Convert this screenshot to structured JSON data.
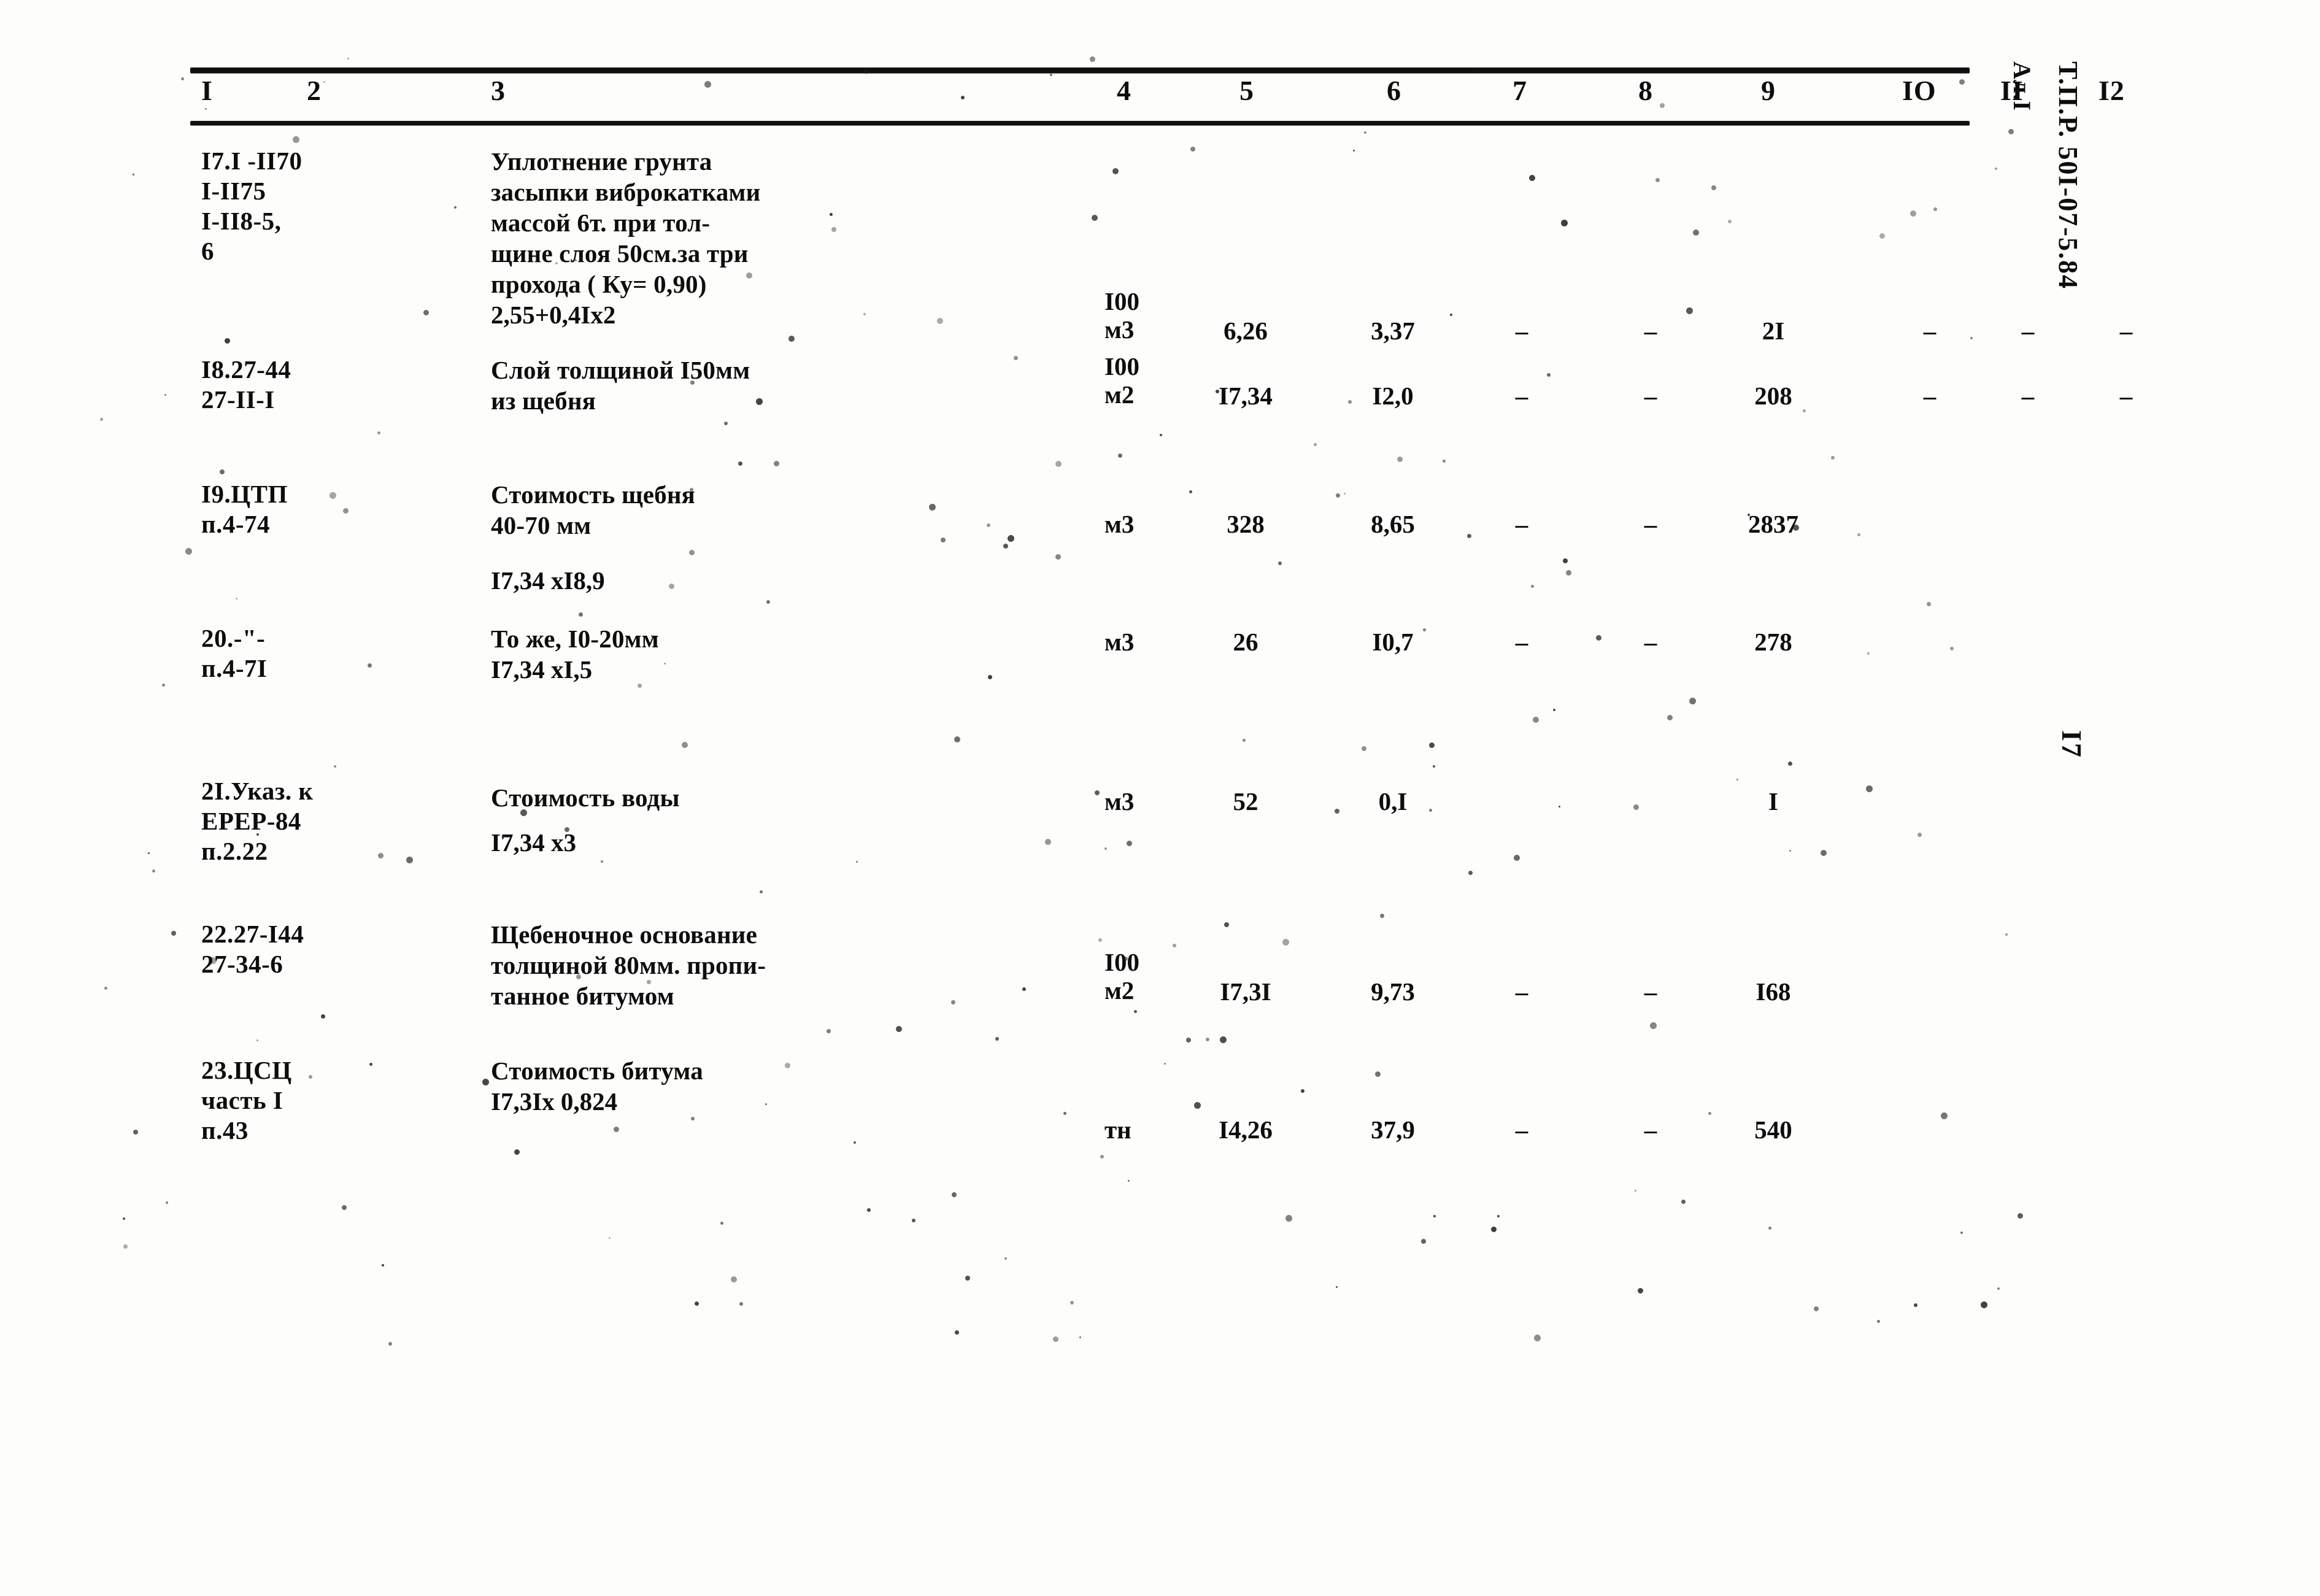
{
  "document": {
    "side_title": "Т.П.Р. 50I-07-5.84",
    "side_sub": "Ал.I",
    "page_number": "I7"
  },
  "table": {
    "column_headers": [
      "I",
      "2",
      "3",
      "4",
      "5",
      "6",
      "7",
      "8",
      "9",
      "IO",
      "II",
      "I2"
    ],
    "rows": [
      {
        "code": "I7.I -II70\nI-II75\nI-II8-5,\n6",
        "description": "Уплотнение грунта\nзасыпки виброкатками\nмассой 6т. при тол-\nщине слоя 50см.за три\nпрохода ( Ку= 0,90)",
        "calc": "2,55+0,4Ix2",
        "unit": "I00\nм3",
        "c5": "6,26",
        "c6": "3,37",
        "c7": "–",
        "c8": "–",
        "c9": "2I",
        "c10": "–",
        "c11": "–",
        "c12": "–"
      },
      {
        "code": "I8.27-44\n27-II-I",
        "description": "Слой толщиной   I50мм\nиз щебня",
        "calc": "",
        "unit": "I00\nм2",
        "c5": "I7,34",
        "c6": "I2,0",
        "c7": "–",
        "c8": "–",
        "c9": "208",
        "c10": "–",
        "c11": "–",
        "c12": "–"
      },
      {
        "code": "I9.ЦТП\nп.4-74",
        "description": "Стоимость щебня\n40-70 мм",
        "calc": "I7,34 xI8,9",
        "unit": "м3",
        "c5": "328",
        "c6": "8,65",
        "c7": "–",
        "c8": "–",
        "c9": "2837",
        "c10": "",
        "c11": "",
        "c12": ""
      },
      {
        "code": "20.-\"-\nп.4-7I",
        "description": "То же, I0-20мм",
        "calc": "I7,34 xI,5",
        "unit": "м3",
        "c5": "26",
        "c6": "I0,7",
        "c7": "–",
        "c8": "–",
        "c9": "278",
        "c10": "",
        "c11": "",
        "c12": ""
      },
      {
        "code": "2I.Указ. к\nЕРЕР-84\nп.2.22",
        "description": "Стоимость воды",
        "calc": "I7,34 х3",
        "unit": "м3",
        "c5": "52",
        "c6": "0,I",
        "c7": "",
        "c8": "",
        "c9": "I",
        "c10": "",
        "c11": "",
        "c12": ""
      },
      {
        "code": "22.27-I44\n27-34-6",
        "description": "Щебеночное основание\nтолщиной 80мм. пропи-\nтанное битумом",
        "calc": "",
        "unit": "I00\nм2",
        "c5": "I7,3I",
        "c6": "9,73",
        "c7": "–",
        "c8": "–",
        "c9": "I68",
        "c10": "",
        "c11": "",
        "c12": ""
      },
      {
        "code": "23.ЦСЦ\nчасть I\nп.43",
        "description": "Стоимость битума",
        "calc": "I7,3Iх 0,824",
        "unit": "тн",
        "c5": "I4,26",
        "c6": "37,9",
        "c7": "–",
        "c8": "–",
        "c9": "540",
        "c10": "",
        "c11": "",
        "c12": ""
      }
    ]
  }
}
